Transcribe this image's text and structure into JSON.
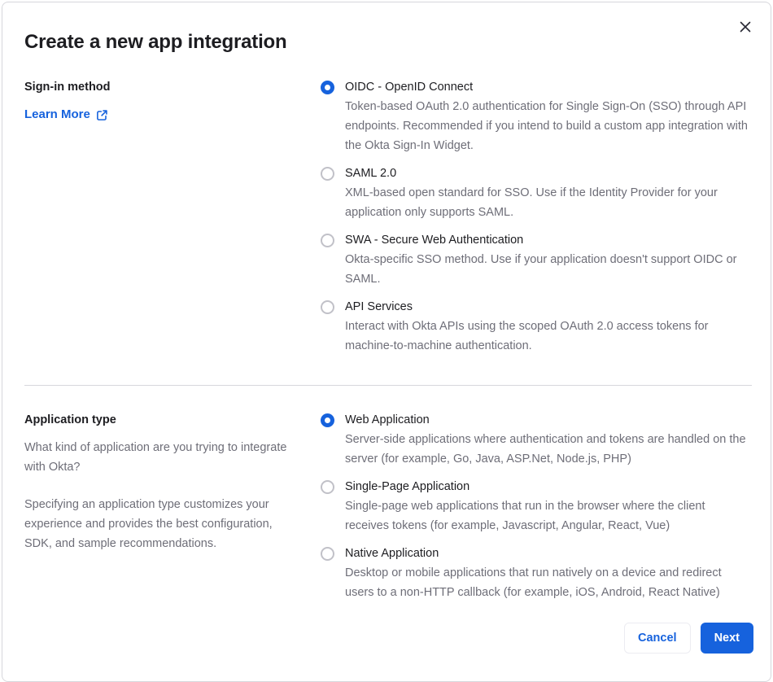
{
  "modal": {
    "title": "Create a new app integration"
  },
  "signin_section": {
    "heading": "Sign-in method",
    "learn_more_label": "Learn More",
    "options": [
      {
        "label": "OIDC - OpenID Connect",
        "description": "Token-based OAuth 2.0 authentication for Single Sign-On (SSO) through API endpoints. Recommended if you intend to build a custom app integration with the Okta Sign-In Widget.",
        "selected": true
      },
      {
        "label": "SAML 2.0",
        "description": "XML-based open standard for SSO. Use if the Identity Provider for your application only supports SAML.",
        "selected": false
      },
      {
        "label": "SWA - Secure Web Authentication",
        "description": "Okta-specific SSO method. Use if your application doesn't support OIDC or SAML.",
        "selected": false
      },
      {
        "label": "API Services",
        "description": "Interact with Okta APIs using the scoped OAuth 2.0 access tokens for machine-to-machine authentication.",
        "selected": false
      }
    ]
  },
  "apptype_section": {
    "heading": "Application type",
    "paragraphs": [
      "What kind of application are you trying to integrate with Okta?",
      "Specifying an application type customizes your experience and provides the best configuration, SDK, and sample recommendations."
    ],
    "options": [
      {
        "label": "Web Application",
        "description": "Server-side applications where authentication and tokens are handled on the server (for example, Go, Java, ASP.Net, Node.js, PHP)",
        "selected": true
      },
      {
        "label": "Single-Page Application",
        "description": "Single-page web applications that run in the browser where the client receives tokens (for example, Javascript, Angular, React, Vue)",
        "selected": false
      },
      {
        "label": "Native Application",
        "description": "Desktop or mobile applications that run natively on a device and redirect users to a non-HTTP callback (for example, iOS, Android, React Native)",
        "selected": false
      }
    ]
  },
  "footer": {
    "cancel_label": "Cancel",
    "next_label": "Next"
  },
  "icons": {
    "close": "close-icon",
    "external_link": "external-link-icon",
    "radio": "radio-icon"
  },
  "colors": {
    "accent_blue": "#1662dd",
    "text_dark": "#1d1d21",
    "text_gray": "#6e6e78",
    "border_gray": "#d7d7dc"
  }
}
